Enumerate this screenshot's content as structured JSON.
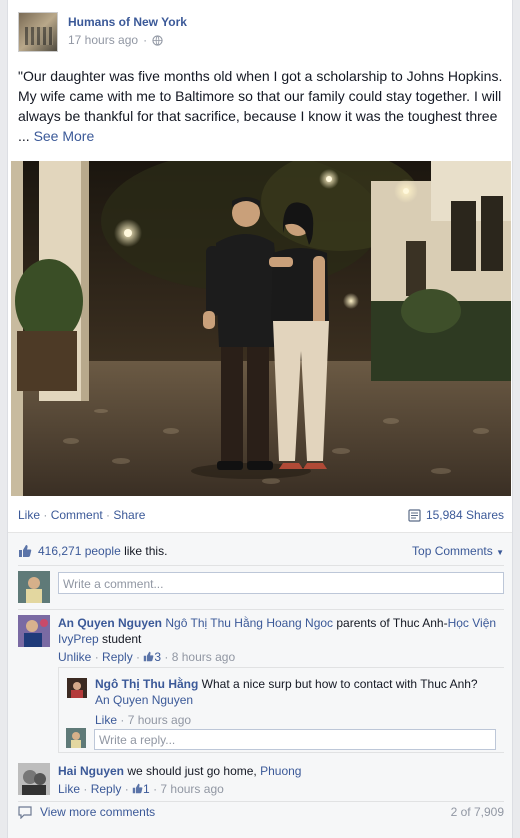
{
  "post": {
    "page_name": "Humans of New York",
    "time": "17 hours ago",
    "privacy_icon": "globe-icon",
    "text": "\"Our daughter was five months old when I got a scholarship to Johns Hopkins. My wife came with me to Baltimore so that our family could stay together. I will always be thankful for that sacrifice, because I know it was the toughest three",
    "ellipsis": " ... ",
    "see_more": "See More"
  },
  "actions": {
    "like": "Like",
    "comment": "Comment",
    "share": "Share",
    "separator": " · ",
    "shares_count": "15,984 Shares"
  },
  "likes": {
    "count": "416,271 people",
    "suffix": " like this.",
    "top_comments": "Top Comments"
  },
  "comment_input": {
    "placeholder": "Write a comment..."
  },
  "comments": [
    {
      "author": "An Quyen Nguyen",
      "text_link1": "Ngô Thị Thu Hằng",
      "text_link2": "Hoang Ngoc",
      "text_mid": " parents of Thuc Anh-",
      "text_link3": "Học Viện IvyPrep",
      "text_end": " student",
      "unlike": "Unlike",
      "reply": "Reply",
      "like_count": "3",
      "time": "8 hours ago"
    },
    {
      "author": "Ngô Thị Thu Hằng",
      "text": "What a nice surp but how to contact with Thuc Anh?",
      "mention": "An Quyen Nguyen",
      "like": "Like",
      "time": "7 hours ago"
    },
    {
      "author": "Hai Nguyen",
      "text": "we should just go home, ",
      "mention": "Phuong",
      "like": "Like",
      "reply": "Reply",
      "like_count": "1",
      "time": "7 hours ago"
    }
  ],
  "reply_input": {
    "placeholder": "Write a reply..."
  },
  "view_more": {
    "label": "View more comments",
    "count": "2 of 7,909"
  },
  "colors": {
    "link": "#3b5998",
    "muted": "#9197a3",
    "ufi_bg": "#f6f7f8"
  }
}
